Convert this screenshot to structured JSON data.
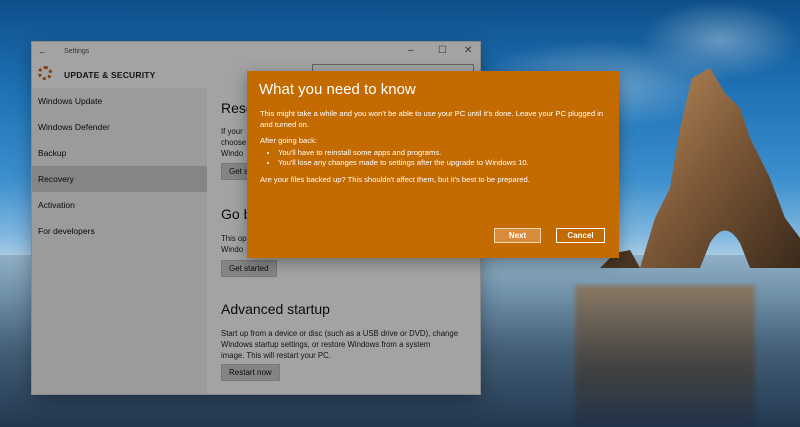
{
  "settings_window": {
    "title": "Settings",
    "section_title": "UPDATE & SECURITY",
    "nav_items": [
      {
        "label": "Windows Update"
      },
      {
        "label": "Windows Defender"
      },
      {
        "label": "Backup"
      },
      {
        "label": "Recovery",
        "selected": true
      },
      {
        "label": "Activation"
      },
      {
        "label": "For developers"
      }
    ],
    "reset": {
      "heading": "Rese",
      "text_line1": "If your",
      "text_line2": "choose",
      "text_line3": "Windo",
      "button": "Get st"
    },
    "go_back": {
      "heading": "Go b",
      "text_line1": "This op",
      "text_line2": "Windo",
      "button": "Get started"
    },
    "advanced": {
      "heading": "Advanced startup",
      "text_line1": "Start up from a device or disc (such as a USB drive or DVD), change",
      "text_line2": "Windows startup settings, or restore Windows from a system",
      "text_line3": "image. This will restart your PC.",
      "button": "Restart now"
    }
  },
  "dialog": {
    "title": "What you need to know",
    "paragraph1": "This might take a while and you won't be able to use your PC until it's done. Leave your PC plugged in and turned on.",
    "after_label": "After going back:",
    "bullets": [
      "You'll have to reinstall some apps and programs.",
      "You'll lose any changes made to settings after the upgrade to Windows 10."
    ],
    "paragraph2": "Are your files backed up? This shouldn't affect them, but it's best to be prepared.",
    "next_label": "Next",
    "cancel_label": "Cancel",
    "accent_color": "#c36a00"
  }
}
